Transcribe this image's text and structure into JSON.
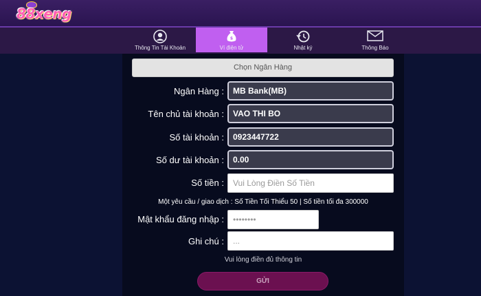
{
  "header": {
    "logo_text": "88xeng"
  },
  "tabs": [
    {
      "label": "Thông Tin Tài Khoản",
      "icon": "user-icon"
    },
    {
      "label": "Ví điện tử",
      "icon": "wallet-icon",
      "active": true
    },
    {
      "label": "Nhật ký",
      "icon": "history-icon"
    },
    {
      "label": "Thông Báo",
      "icon": "mail-icon"
    }
  ],
  "form": {
    "choose_bank": "Chọn Ngân Hàng",
    "bank_label": "Ngân Hàng :",
    "bank_value": "MB Bank(MB)",
    "owner_label": "Tên chủ tài khoản :",
    "owner_value": "VAO THI BO",
    "account_label": "Số tài khoản :",
    "account_value": "0923447722",
    "balance_label": "Số dư tài khoản :",
    "balance_value": "0.00",
    "amount_label": "Số tiền :",
    "amount_placeholder": "Vui Lòng Điền Số Tiền",
    "limit_note": "Một yêu cầu / giao dịch : Số Tiền Tối Thiểu 50 | Số tiền tối đa 300000",
    "password_label": "Mật khẩu đăng nhập :",
    "password_placeholder": "••••••••",
    "memo_label": "Ghi chú :",
    "memo_placeholder": "...",
    "fill_note": "Vui lòng điền đủ thông tin",
    "submit_label": "GỬI"
  },
  "colors": {
    "background": "#0c1233",
    "panel": "#070b1e",
    "active_tab": "#c05ff0",
    "submit": "#6b1050"
  }
}
